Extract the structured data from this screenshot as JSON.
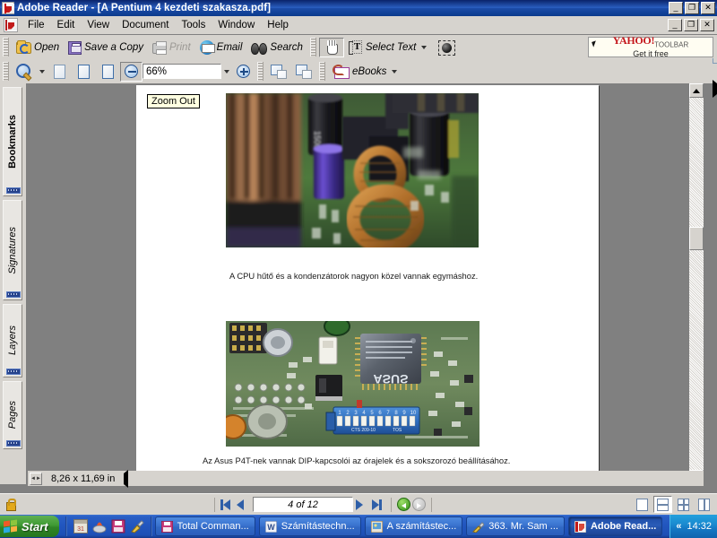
{
  "window": {
    "title": "Adobe Reader - [A Pentium 4 kezdeti szakasza.pdf]",
    "app_icon": "adobe-reader-icon",
    "minimize": "_",
    "maximize": "❐",
    "close": "✕"
  },
  "menu": {
    "items": [
      {
        "label": "File"
      },
      {
        "label": "Edit"
      },
      {
        "label": "View"
      },
      {
        "label": "Document"
      },
      {
        "label": "Tools"
      },
      {
        "label": "Window"
      },
      {
        "label": "Help"
      }
    ]
  },
  "toolbar_file": {
    "buttons": [
      {
        "label": "Open",
        "icon": "open-folder-icon",
        "disabled": false
      },
      {
        "label": "Save a Copy",
        "icon": "save-floppy-icon",
        "disabled": false
      },
      {
        "label": "Print",
        "icon": "printer-icon",
        "disabled": true
      },
      {
        "label": "Email",
        "icon": "email-globe-icon",
        "disabled": false
      },
      {
        "label": "Search",
        "icon": "binoculars-icon",
        "disabled": false
      }
    ]
  },
  "toolbar_tools": {
    "hand_icon": "hand-tool-icon",
    "select_text_label": "Select Text",
    "select_text_icon": "select-text-icon",
    "snapshot_icon": "snapshot-camera-icon"
  },
  "yahoo_toolbar": {
    "brand": "YAHOO!",
    "suffix": "TOOLBAR",
    "tagline": "Get it free",
    "brand_color": "#c4161c"
  },
  "toolbar_zoom": {
    "zoom_tool_icon": "zoom-in-magnifier-icon",
    "actual_size_icon": "actual-size-page-icon",
    "fit_page_icon": "fit-page-icon",
    "fit_width_icon": "fit-width-icon",
    "zoom_out_icon": "zoom-out-minus-icon",
    "zoom_value": "66%",
    "zoom_in_icon": "zoom-in-plus-icon",
    "rotate_cw_icon": "rotate-clockwise-icon",
    "rotate_ccw_icon": "rotate-counterclockwise-icon",
    "ebooks_label": "eBooks",
    "ebooks_icon": "ebooks-icon"
  },
  "tooltip": {
    "text": "Zoom Out"
  },
  "sidebar": {
    "tabs": [
      {
        "label": "Bookmarks",
        "active": true
      },
      {
        "label": "Signatures",
        "active": false
      },
      {
        "label": "Layers",
        "active": false
      },
      {
        "label": "Pages",
        "active": false
      }
    ]
  },
  "document": {
    "captions": [
      "A CPU hűtő és a kondenzátorok nagyon közel vannak egymáshoz.",
      "Az Asus P4T-nek vannak DIP-kapcsolói az órajelek és a sokszorozó beállításához."
    ],
    "images": [
      {
        "name": "cpu-cooler-capacitors-photo",
        "alt": "Close-up of motherboard capacitors, toroidal coils and CPU heatsink"
      },
      {
        "name": "asus-p4t-dip-switches-photo",
        "alt": "Asus motherboard with ASUS chip and blue 10-position DIP switch bank"
      }
    ],
    "page_size": "8,26 x 11,69 in"
  },
  "statusbar": {
    "security_icon": "lock-icon",
    "first_page_icon": "first-page-icon",
    "prev_page_icon": "previous-page-icon",
    "page_indicator": "4 of 12",
    "next_page_icon": "next-page-icon",
    "last_page_icon": "last-page-icon",
    "go_back_icon": "go-back-icon",
    "go_forward_icon": "go-forward-icon",
    "view_buttons": [
      {
        "name": "single-page-view",
        "selected": false
      },
      {
        "name": "continuous-view",
        "selected": true
      },
      {
        "name": "facing-pages-view",
        "selected": false
      },
      {
        "name": "continuous-facing-view",
        "selected": false
      }
    ]
  },
  "taskbar": {
    "start_label": "Start",
    "quick_launch": [
      {
        "name": "calendar-icon"
      },
      {
        "name": "nero-burning-icon"
      },
      {
        "name": "floppy-save-icon"
      },
      {
        "name": "paint-brush-icon"
      }
    ],
    "tasks": [
      {
        "label": "Total Comman...",
        "icon": "total-commander-icon",
        "active": false
      },
      {
        "label": "Számítástechn...",
        "icon": "word-document-icon",
        "active": false
      },
      {
        "label": "A számítástec...",
        "icon": "image-viewer-icon",
        "active": false
      },
      {
        "label": "363. Mr. Sam ...",
        "icon": "paint-brush-icon",
        "active": false
      },
      {
        "label": "Adobe Read...",
        "icon": "adobe-reader-icon",
        "active": true
      }
    ],
    "tray": {
      "expand_chevron": "«",
      "clock": "14:32"
    }
  }
}
